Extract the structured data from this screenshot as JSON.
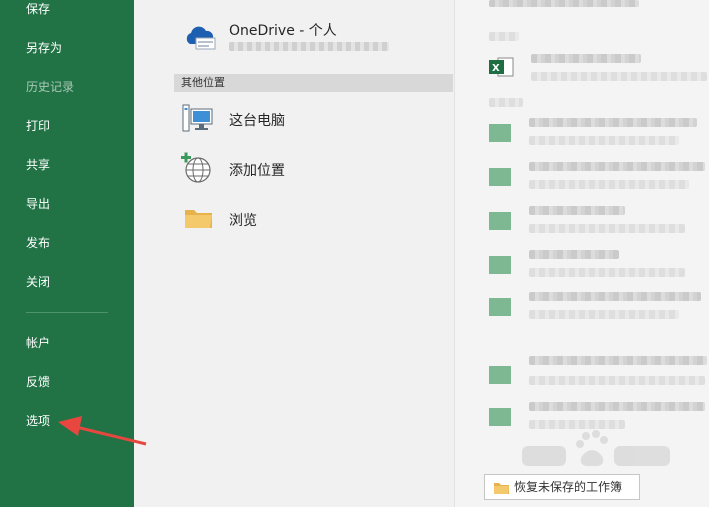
{
  "nav": {
    "items": [
      {
        "label": "保存"
      },
      {
        "label": "另存为"
      },
      {
        "label": "历史记录"
      },
      {
        "label": "打印"
      },
      {
        "label": "共享"
      },
      {
        "label": "导出"
      },
      {
        "label": "发布"
      },
      {
        "label": "关闭"
      },
      {
        "label": "帐户"
      },
      {
        "label": "反馈"
      },
      {
        "label": "选项"
      }
    ]
  },
  "locations": {
    "onedrive_label": "OneDrive - 个人",
    "other_header": "其他位置",
    "this_pc": "这台电脑",
    "add_place": "添加位置",
    "browse": "浏览"
  },
  "recent": {
    "restore_button": "恢复未保存的工作簿"
  },
  "colors": {
    "nav_bg": "#217346",
    "accent": "#217346",
    "arrow": "#e8473f"
  },
  "icons": [
    "onedrive-icon",
    "computer-icon",
    "add-location-icon",
    "folder-icon",
    "excel-file-icon"
  ]
}
